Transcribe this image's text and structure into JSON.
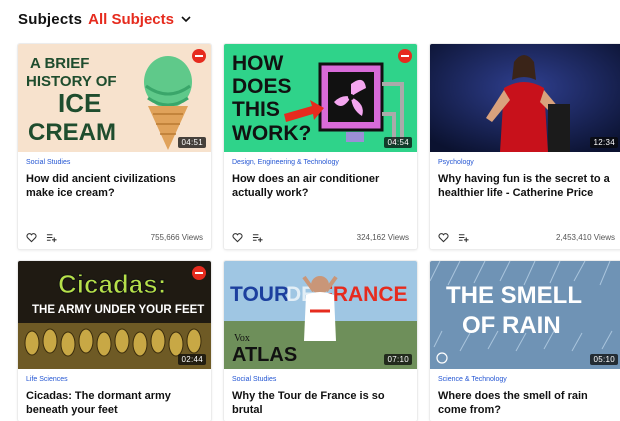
{
  "header": {
    "label": "Subjects",
    "selected": "All Subjects"
  },
  "cards": [
    {
      "subject": "Social Studies",
      "title": "How did ancient civilizations make ice cream?",
      "views": "755,666 Views",
      "duration": "04:51",
      "thumb_text": [
        "A BRIEF",
        "HISTORY OF",
        "ICE",
        "CREAM"
      ]
    },
    {
      "subject": "Design, Engineering & Technology",
      "title": "How does an air conditioner actually work?",
      "views": "324,162 Views",
      "duration": "04:54",
      "thumb_text": [
        "HOW",
        "DOES",
        "THIS",
        "WORK?"
      ]
    },
    {
      "subject": "Psychology",
      "title": "Why having fun is the secret to a healthier life - Catherine Price",
      "views": "2,453,410 Views",
      "duration": "12:34",
      "thumb_text": []
    },
    {
      "subject": "Life Sciences",
      "title": "Cicadas: The dormant army beneath your feet",
      "views": "",
      "duration": "02:44",
      "thumb_text": [
        "Cicadas:",
        "THE ARMY UNDER YOUR FEET"
      ]
    },
    {
      "subject": "Social Studies",
      "title": "Why the Tour de France is so brutal",
      "views": "",
      "duration": "07:10",
      "thumb_text": [
        "TOUR",
        "DE",
        "FRANCE",
        "Vox",
        "ATLAS"
      ]
    },
    {
      "subject": "Science & Technology",
      "title": "Where does the smell of rain come from?",
      "views": "",
      "duration": "05:10",
      "thumb_text": [
        "THE SMELL",
        "OF RAIN"
      ]
    }
  ],
  "icons": {
    "favorite": "heart-icon",
    "add": "add-to-list-icon",
    "chevron": "chevron-down-icon"
  },
  "colors": {
    "accent": "#e62b1e",
    "subject_link": "#2456d3"
  }
}
